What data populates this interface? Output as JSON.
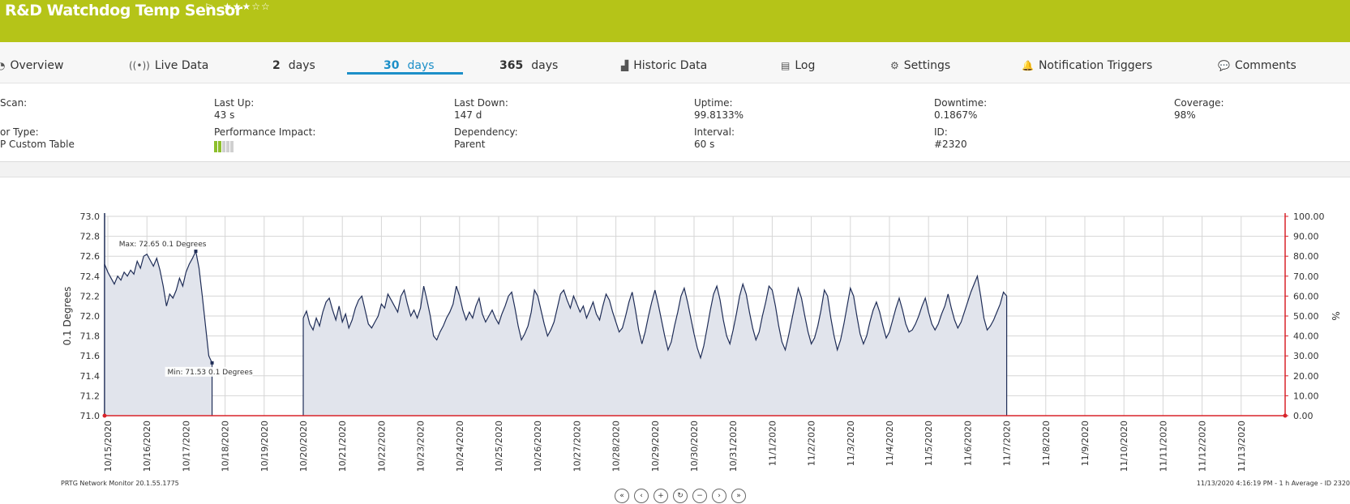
{
  "header": {
    "title": "R&D Watchdog Temp Sensor",
    "flag_icon": "flag-icon",
    "stars": "★★★☆☆",
    "colors": {
      "header_bg": "#b5c418",
      "accent": "#1c8fc8",
      "line": "#1f2d57",
      "fill": "#e1e4ec",
      "right_axis": "#d8232a"
    }
  },
  "tabs": [
    {
      "label": "Overview",
      "icon": "overview-icon"
    },
    {
      "label": "Live Data",
      "icon": "live-data-icon"
    },
    {
      "num": "2",
      "label": "days"
    },
    {
      "num": "30",
      "label": "days"
    },
    {
      "num": "365",
      "label": "days"
    },
    {
      "label": "Historic Data",
      "icon": "chart-icon"
    },
    {
      "label": "Log",
      "icon": "log-icon"
    },
    {
      "label": "Settings",
      "icon": "gear-icon"
    },
    {
      "label": "Notification Triggers",
      "icon": "bell-icon"
    },
    {
      "label": "Comments",
      "icon": "comment-icon"
    }
  ],
  "active_tab": "30 days",
  "info": {
    "scan_label": "Scan:",
    "sensor_type_label": "or Type:",
    "sensor_type_value": "P Custom Table",
    "last_up_label": "Last Up:",
    "last_up_value": "43 s",
    "perf_label": "Performance Impact:",
    "perf_level": 2,
    "perf_max": 5,
    "last_down_label": "Last Down:",
    "last_down_value": "147 d",
    "dependency_label": "Dependency:",
    "dependency_value": "Parent",
    "uptime_label": "Uptime:",
    "uptime_value": "99.8133%",
    "interval_label": "Interval:",
    "interval_value": "60 s",
    "downtime_label": "Downtime:",
    "downtime_value": "0.1867%",
    "id_label": "ID:",
    "id_value": "#2320",
    "coverage_label": "Coverage:",
    "coverage_value": "98%"
  },
  "chart_data": {
    "type": "line",
    "ylabel": "0.1 Degrees",
    "ylabel_right": "%",
    "ylim": [
      71.0,
      73.0
    ],
    "ylim_right": [
      0,
      100
    ],
    "yticks": [
      "73.0",
      "72.8",
      "72.6",
      "72.4",
      "72.2",
      "72.0",
      "71.8",
      "71.6",
      "71.4",
      "71.2",
      "71.0"
    ],
    "yticks_right": [
      "100.00",
      "90.00",
      "80.00",
      "70.00",
      "60.00",
      "50.00",
      "40.00",
      "30.00",
      "20.00",
      "10.00",
      "0.00"
    ],
    "categories": [
      "10/15/2020",
      "10/16/2020",
      "10/17/2020",
      "10/18/2020",
      "10/19/2020",
      "10/20/2020",
      "10/21/2020",
      "10/22/2020",
      "10/23/2020",
      "10/24/2020",
      "10/25/2020",
      "10/26/2020",
      "10/27/2020",
      "10/28/2020",
      "10/29/2020",
      "10/30/2020",
      "10/31/2020",
      "11/1/2020",
      "11/2/2020",
      "11/3/2020",
      "11/4/2020",
      "11/5/2020",
      "11/6/2020",
      "11/7/2020",
      "11/8/2020",
      "11/9/2020",
      "11/10/2020",
      "11/11/2020",
      "11/12/2020",
      "11/13/2020"
    ],
    "max_label": "Max: 72.65 0.1 Degrees",
    "min_label": "Min: 71.53 0.1 Degrees",
    "grid": true,
    "series": [
      {
        "segment": 1,
        "x_start": "10/14/2020 22:00",
        "x_step_hours": 2,
        "values": [
          72.52,
          72.44,
          72.38,
          72.32,
          72.4,
          72.36,
          72.44,
          72.4,
          72.46,
          72.42,
          72.55,
          72.48,
          72.6,
          72.62,
          72.56,
          72.5,
          72.58,
          72.46,
          72.3,
          72.1,
          72.22,
          72.18,
          72.26,
          72.38,
          72.3,
          72.44,
          72.52,
          72.58,
          72.65,
          72.48,
          72.2,
          71.9,
          71.6,
          71.53
        ]
      },
      {
        "segment": 2,
        "x_start": "10/20/2020 00:00",
        "x_step_hours": 2,
        "values": [
          71.98,
          72.05,
          71.92,
          71.86,
          71.98,
          71.9,
          72.04,
          72.14,
          72.18,
          72.06,
          71.96,
          72.1,
          71.94,
          72.02,
          71.88,
          71.96,
          72.08,
          72.16,
          72.2,
          72.06,
          71.92,
          71.88,
          71.94,
          72.0,
          72.12,
          72.08,
          72.22,
          72.16,
          72.1,
          72.04,
          72.2,
          72.26,
          72.12,
          72.0,
          72.06,
          71.98,
          72.08,
          72.3,
          72.16,
          72.0,
          71.8,
          71.76,
          71.84,
          71.9,
          71.98,
          72.04,
          72.12,
          72.3,
          72.2,
          72.06,
          71.96,
          72.04,
          71.98,
          72.1,
          72.18,
          72.02,
          71.94,
          72.0,
          72.06,
          71.98,
          71.92,
          72.02,
          72.1,
          72.2,
          72.24,
          72.08,
          71.9,
          71.76,
          71.82,
          71.9,
          72.04,
          72.26,
          72.2,
          72.06,
          71.92,
          71.8,
          71.86,
          71.94,
          72.08,
          72.22,
          72.26,
          72.16,
          72.08,
          72.2,
          72.12,
          72.04,
          72.1,
          71.98,
          72.06,
          72.14,
          72.02,
          71.96,
          72.1,
          72.22,
          72.16,
          72.04,
          71.94,
          71.84,
          71.88,
          72.0,
          72.14,
          72.24,
          72.06,
          71.86,
          71.72,
          71.84,
          72.0,
          72.14,
          72.26,
          72.12,
          71.96,
          71.8,
          71.66,
          71.74,
          71.9,
          72.04,
          72.2,
          72.28,
          72.14,
          71.98,
          71.82,
          71.68,
          71.58,
          71.7,
          71.88,
          72.06,
          72.22,
          72.3,
          72.16,
          71.96,
          71.8,
          71.72,
          71.86,
          72.02,
          72.2,
          72.32,
          72.22,
          72.04,
          71.88,
          71.76,
          71.84,
          72.0,
          72.14,
          72.3,
          72.26,
          72.1,
          71.9,
          71.74,
          71.66,
          71.8,
          71.96,
          72.12,
          72.28,
          72.18,
          72.0,
          71.84,
          71.72,
          71.78,
          71.9,
          72.06,
          72.26,
          72.2,
          71.98,
          71.8,
          71.66,
          71.76,
          71.92,
          72.1,
          72.28,
          72.2,
          72.0,
          71.82,
          71.72,
          71.8,
          71.94,
          72.06,
          72.14,
          72.04,
          71.9,
          71.78,
          71.84,
          71.96,
          72.08,
          72.18,
          72.06,
          71.92,
          71.84,
          71.86,
          71.92,
          72.0,
          72.1,
          72.18,
          72.04,
          71.92,
          71.86,
          71.92,
          72.02,
          72.1,
          72.22,
          72.08,
          71.96,
          71.88,
          71.94,
          72.04,
          72.14,
          72.24,
          72.32,
          72.4,
          72.2,
          71.98,
          71.86,
          71.9,
          71.96,
          72.04,
          72.12,
          72.24,
          72.2
        ]
      }
    ]
  },
  "footer": {
    "left": "PRTG Network Monitor 20.1.55.1775",
    "right": "11/13/2020 4:16:19 PM - 1 h Average - ID 2320",
    "controls": [
      "«",
      "‹",
      "+",
      "↻",
      "−",
      "›",
      "»"
    ]
  }
}
